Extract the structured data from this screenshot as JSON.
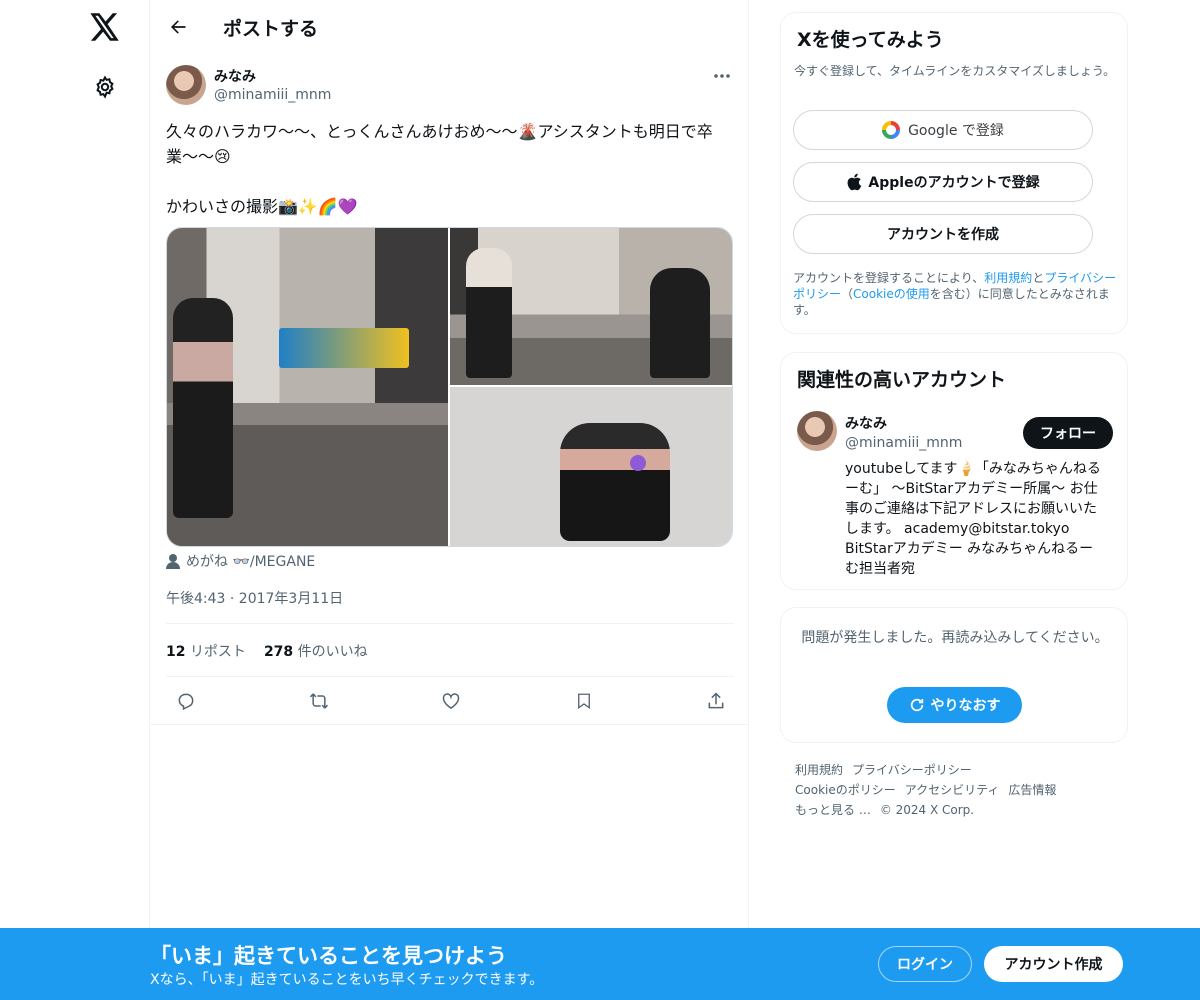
{
  "header": {
    "title": "ポストする"
  },
  "tweet": {
    "author_name": "みなみ",
    "author_handle": "@minamiii_mnm",
    "text": "久々のハラカワ〜〜、とっくんさんあけおめ〜〜🌋アシスタントも明日で卒業〜〜😢\n\nかわいさの撮影📸✨🌈💜",
    "tagged": "めがね 👓/MEGANE",
    "timestamp": "午後4:43 · 2017年3月11日",
    "reposts_count": "12",
    "reposts_label": "リポスト",
    "likes_count": "278",
    "likes_label": "件のいいね"
  },
  "signup_card": {
    "title": "Xを使ってみよう",
    "subtitle": "今すぐ登録して、タイムラインをカスタマイズしましょう。",
    "google_label": "Google で登録",
    "apple_label": "Appleのアカウントで登録",
    "create_label": "アカウントを作成",
    "legal_prefix": "アカウントを登録することにより、",
    "legal_terms": "利用規約",
    "legal_and": "と",
    "legal_privacy": "プライバシーポリシー",
    "legal_paren_open": "（",
    "legal_cookie": "Cookieの使用",
    "legal_suffix": "を含む）に同意したとみなされます。"
  },
  "related_card": {
    "title": "関連性の高いアカウント",
    "name": "みなみ",
    "handle": "@minamiii_mnm",
    "follow_label": "フォロー",
    "bio": "youtubeしてます🍦「みなみちゃんねるーむ」 〜BitStarアカデミー所属〜 お仕事のご連絡は下記アドレスにお願いいたします。 academy@bitstar.tokyo BitStarアカデミー みなみちゃんねるーむ担当者宛"
  },
  "error_card": {
    "message": "問題が発生しました。再読み込みしてください。",
    "retry_label": "やりなおす"
  },
  "footer": {
    "terms": "利用規約",
    "privacy": "プライバシーポリシー",
    "cookie": "Cookieのポリシー",
    "accessibility": "アクセシビリティ",
    "ads": "広告情報",
    "more": "もっと見る …",
    "copyright": "© 2024 X Corp."
  },
  "bottom_banner": {
    "title": "「いま」起きていることを見つけよう",
    "subtitle": "Xなら、「いま」起きていることをいち早くチェックできます。",
    "login_label": "ログイン",
    "signup_label": "アカウント作成"
  },
  "colors": {
    "accent": "#1d9bf0",
    "text": "#0f1419",
    "muted": "#536471"
  }
}
